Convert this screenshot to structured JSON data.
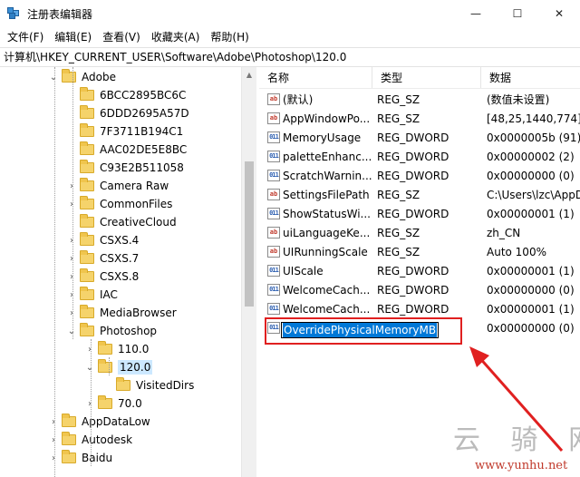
{
  "window": {
    "title": "注册表编辑器",
    "controls": [
      "—",
      "☐",
      "✕"
    ]
  },
  "menu": [
    "文件(F)",
    "编辑(E)",
    "查看(V)",
    "收藏夹(A)",
    "帮助(H)"
  ],
  "address": "计算机\\HKEY_CURRENT_USER\\Software\\Adobe\\Photoshop\\120.0",
  "tree": [
    {
      "label": "Adobe",
      "expander": "⌄"
    },
    {
      "label": "6BCC2895BC6C",
      "expander": ""
    },
    {
      "label": "6DDD2695A57D",
      "expander": ""
    },
    {
      "label": "7F3711B194C1",
      "expander": ""
    },
    {
      "label": "AAC02DE5E8BC",
      "expander": ""
    },
    {
      "label": "C93E2B511058",
      "expander": ""
    },
    {
      "label": "Camera Raw",
      "expander": "›"
    },
    {
      "label": "CommonFiles",
      "expander": "›"
    },
    {
      "label": "CreativeCloud",
      "expander": ""
    },
    {
      "label": "CSXS.4",
      "expander": "›"
    },
    {
      "label": "CSXS.7",
      "expander": "›"
    },
    {
      "label": "CSXS.8",
      "expander": "›"
    },
    {
      "label": "IAC",
      "expander": "›"
    },
    {
      "label": "MediaBrowser",
      "expander": "›"
    },
    {
      "label": "Photoshop",
      "expander": "⌄"
    },
    {
      "label": "110.0",
      "expander": "›"
    },
    {
      "label": "120.0",
      "expander": "⌄"
    },
    {
      "label": "VisitedDirs",
      "expander": ""
    },
    {
      "label": "70.0",
      "expander": "›"
    },
    {
      "label": "AppDataLow",
      "expander": "›"
    },
    {
      "label": "Autodesk",
      "expander": "›"
    },
    {
      "label": "Baidu",
      "expander": "›"
    }
  ],
  "columns": {
    "name": "名称",
    "type": "类型",
    "data": "数据"
  },
  "values": [
    {
      "icon": "ab",
      "name": "(默认)",
      "type": "REG_SZ",
      "data": "(数值未设置)"
    },
    {
      "icon": "ab",
      "name": "AppWindowPo...",
      "type": "REG_SZ",
      "data": "[48,25,1440,774]"
    },
    {
      "icon": "011",
      "name": "MemoryUsage",
      "type": "REG_DWORD",
      "data": "0x0000005b (91)"
    },
    {
      "icon": "011",
      "name": "paletteEnhanc...",
      "type": "REG_DWORD",
      "data": "0x00000002 (2)"
    },
    {
      "icon": "011",
      "name": "ScratchWarnin...",
      "type": "REG_DWORD",
      "data": "0x00000000 (0)"
    },
    {
      "icon": "ab",
      "name": "SettingsFilePath",
      "type": "REG_SZ",
      "data": "C:\\Users\\lzc\\AppD"
    },
    {
      "icon": "011",
      "name": "ShowStatusWi...",
      "type": "REG_DWORD",
      "data": "0x00000001 (1)"
    },
    {
      "icon": "ab",
      "name": "uiLanguageKe...",
      "type": "REG_SZ",
      "data": "zh_CN"
    },
    {
      "icon": "ab",
      "name": "UIRunningScale",
      "type": "REG_SZ",
      "data": "Auto 100%"
    },
    {
      "icon": "011",
      "name": "UIScale",
      "type": "REG_DWORD",
      "data": "0x00000001 (1)"
    },
    {
      "icon": "011",
      "name": "WelcomeCach...",
      "type": "REG_DWORD",
      "data": "0x00000000 (0)"
    },
    {
      "icon": "011",
      "name": "WelcomeCach...",
      "type": "REG_DWORD",
      "data": "0x00000001 (1)"
    },
    {
      "icon": "011",
      "name": "",
      "type": "",
      "data": "0x00000000 (0)"
    }
  ],
  "editing_value": "OverridePhysicalMemoryMB",
  "colors": {
    "highlight_box": "#e02020",
    "selection": "#0078d7",
    "folder": "#f5d36b"
  },
  "watermark": {
    "text": "云 骑 网",
    "url": "www.yunhu.net"
  }
}
